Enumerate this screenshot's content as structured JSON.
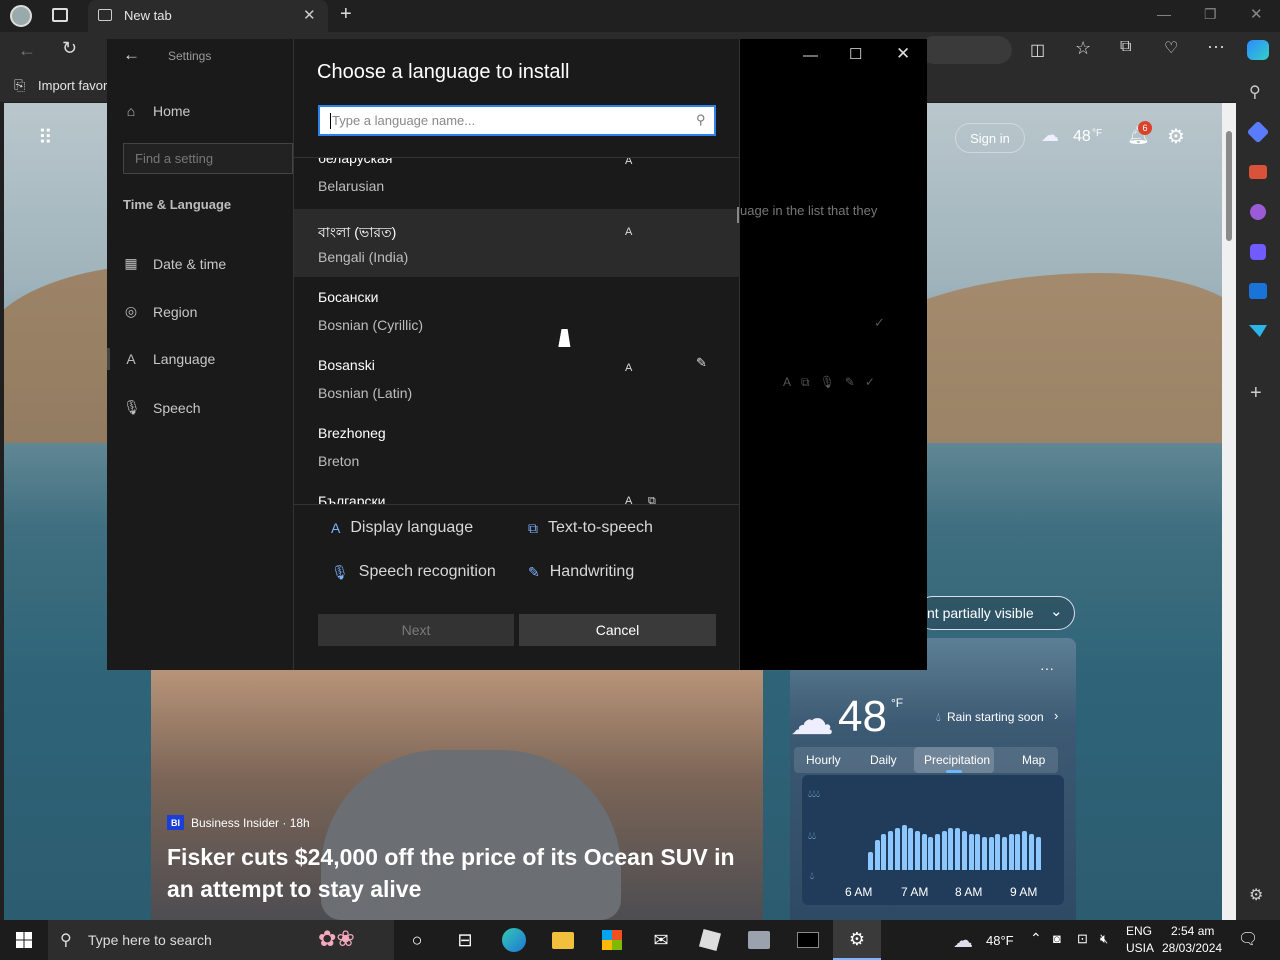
{
  "browser": {
    "tab_title": "New tab",
    "favorites_label": "Import favori",
    "sign_in": "Sign in",
    "header_temp": "48",
    "header_temp_unit": "°F",
    "notif_count": "6"
  },
  "settings": {
    "title": "Settings",
    "home": "Home",
    "search_placeholder": "Find a setting",
    "section": "Time & Language",
    "nav": [
      {
        "label": "Date & time"
      },
      {
        "label": "Region"
      },
      {
        "label": "Language"
      },
      {
        "label": "Speech"
      }
    ],
    "bg_text": "uage in the list that they"
  },
  "dialog": {
    "title": "Choose a language to install",
    "search_placeholder": "Type a language name...",
    "languages": [
      {
        "native": "беларуская",
        "english": "Belarusian"
      },
      {
        "native": "বাংলা (ভারত)",
        "english": "Bengali (India)"
      },
      {
        "native": "Босански",
        "english": "Bosnian (Cyrillic)"
      },
      {
        "native": "Bosanski",
        "english": "Bosnian (Latin)"
      },
      {
        "native": "Brezhoneg",
        "english": "Breton"
      },
      {
        "native": "Български",
        "english": ""
      }
    ],
    "legend": {
      "display": "Display language",
      "tts": "Text-to-speech",
      "speech": "Speech recognition",
      "handwriting": "Handwriting"
    },
    "next": "Next",
    "cancel": "Cancel"
  },
  "news": {
    "source": "Business Insider · 18h",
    "source_badge": "BI",
    "headline": "Fisker cuts $24,000 off the price of its Ocean SUV in an attempt to stay alive"
  },
  "weather": {
    "dropdown": "nt partially visible",
    "temp": "48",
    "unit": "°F",
    "rain": "Rain starting soon",
    "tabs": [
      "Hourly",
      "Daily",
      "Precipitation",
      "Map"
    ],
    "times": [
      "6 AM",
      "7 AM",
      "8 AM",
      "9 AM"
    ],
    "precip_levels": [
      0.3,
      0.5,
      0.6,
      0.65,
      0.7,
      0.75,
      0.7,
      0.65,
      0.6,
      0.55,
      0.6,
      0.65,
      0.7,
      0.7,
      0.65,
      0.6,
      0.6,
      0.55,
      0.55,
      0.6,
      0.55,
      0.6,
      0.6,
      0.65,
      0.6,
      0.55
    ]
  },
  "taskbar": {
    "search_placeholder": "Type here to search",
    "temp": "48°F",
    "lang": "ENG",
    "region": "USIA",
    "time": "2:54 am",
    "date": "28/03/2024"
  }
}
